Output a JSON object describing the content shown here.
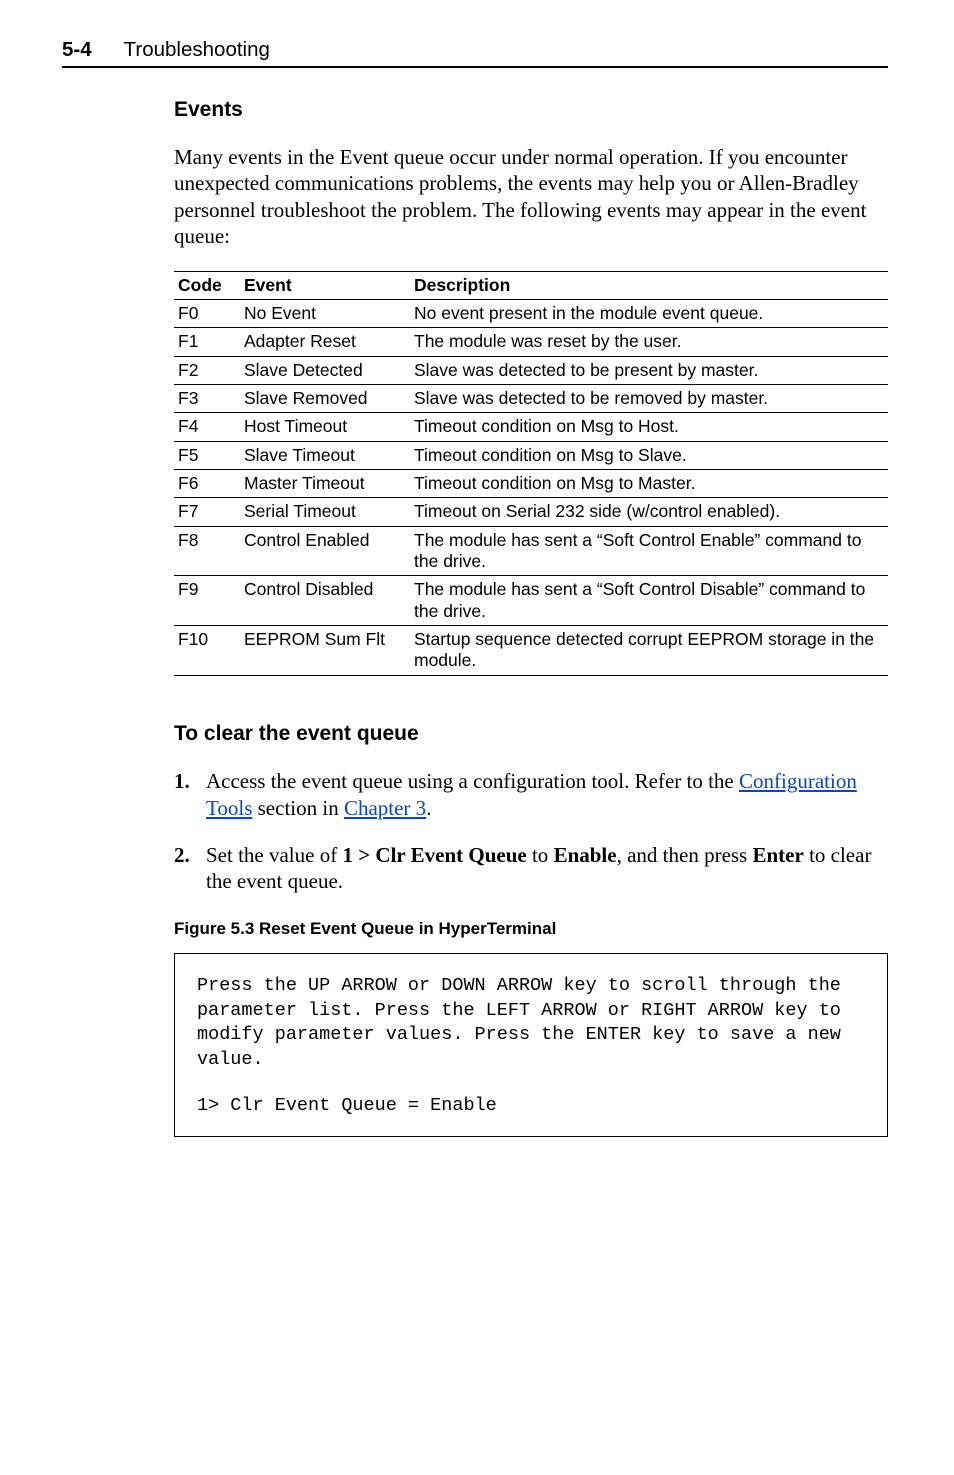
{
  "header": {
    "page_num": "5-4",
    "page_name": "Troubleshooting"
  },
  "events_heading": "Events",
  "events_intro": "Many events in the Event queue occur under normal operation. If you encounter unexpected communications problems, the events may help you or Allen-Bradley personnel troubleshoot the problem. The following events may appear in the event queue:",
  "table": {
    "headers": {
      "code": "Code",
      "event": "Event",
      "desc": "Description"
    },
    "rows": [
      {
        "code": "F0",
        "event": "No Event",
        "desc": "No event present in the module event queue."
      },
      {
        "code": "F1",
        "event": "Adapter Reset",
        "desc": "The module was reset by the user."
      },
      {
        "code": "F2",
        "event": "Slave Detected",
        "desc": "Slave was detected to be present by master."
      },
      {
        "code": "F3",
        "event": "Slave Removed",
        "desc": "Slave was detected to be removed by master."
      },
      {
        "code": "F4",
        "event": "Host Timeout",
        "desc": "Timeout condition on Msg to Host."
      },
      {
        "code": "F5",
        "event": "Slave Timeout",
        "desc": "Timeout condition on Msg to Slave."
      },
      {
        "code": "F6",
        "event": "Master Timeout",
        "desc": "Timeout condition on Msg to Master."
      },
      {
        "code": "F7",
        "event": "Serial Timeout",
        "desc": "Timeout on Serial 232 side (w/control enabled)."
      },
      {
        "code": "F8",
        "event": "Control Enabled",
        "desc": "The module has sent a “Soft Control Enable” command to the drive."
      },
      {
        "code": "F9",
        "event": "Control Disabled",
        "desc": "The module has sent a “Soft Control Disable” command to the drive."
      },
      {
        "code": "F10",
        "event": "EEPROM Sum Flt",
        "desc": "Startup sequence detected corrupt EEPROM storage in the module."
      }
    ]
  },
  "clear_heading": "To clear the event queue",
  "steps": {
    "s1_a": "Access the event queue using a configuration tool. Refer to the ",
    "s1_link1": "Configuration Tools",
    "s1_b": " section in ",
    "s1_link2": "Chapter 3",
    "s1_c": ".",
    "s2_a": "Set the value of ",
    "s2_b1": "1 > Clr Event Queue",
    "s2_b": " to ",
    "s2_b2": "Enable",
    "s2_c": ", and then press ",
    "s2_b3": "Enter",
    "s2_d": " to clear the event queue."
  },
  "figure_caption": "Figure 5.3   Reset Event Queue in HyperTerminal",
  "terminal": {
    "p1": "Press the UP ARROW or DOWN ARROW key to scroll through the parameter list. Press the LEFT ARROW or RIGHT ARROW key to modify parameter values. Press the ENTER key to save a new value.",
    "p2": "1> Clr Event Queue = Enable"
  }
}
